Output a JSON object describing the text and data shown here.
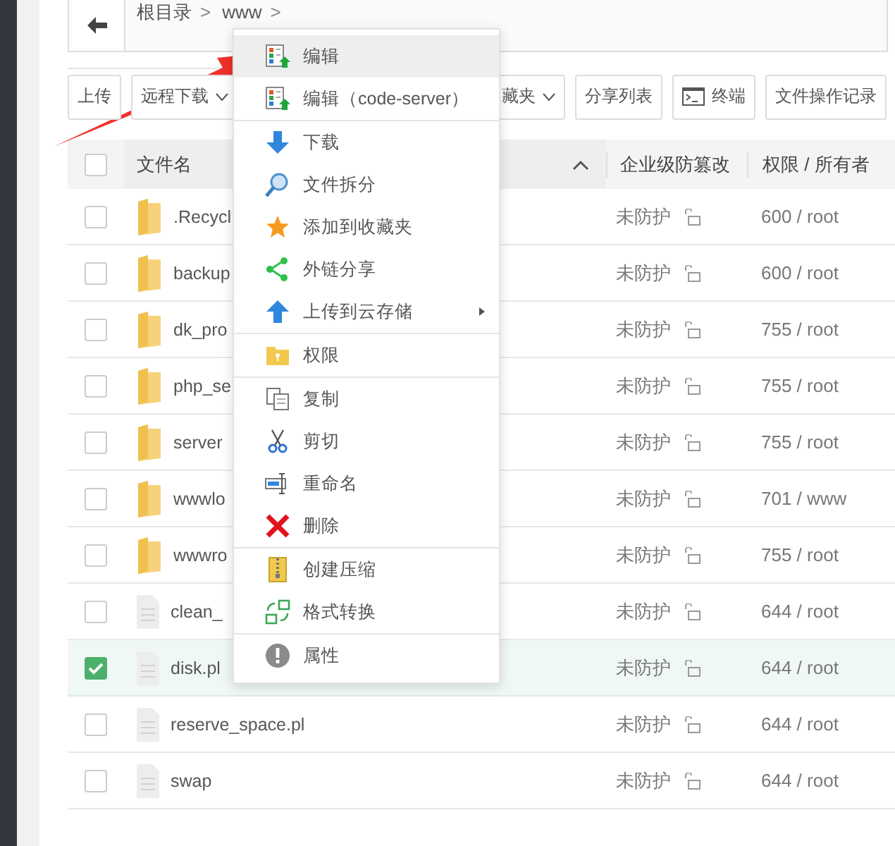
{
  "breadcrumb": {
    "items": [
      "根目录",
      "www"
    ],
    "separator": ">"
  },
  "toolbar": {
    "buttons": [
      {
        "label": "上传",
        "dropdown": false,
        "icon": false
      },
      {
        "label": "远程下载",
        "dropdown": true,
        "icon": false
      },
      {
        "label": "藏夹",
        "dropdown": true,
        "icon": false
      },
      {
        "label": "分享列表",
        "dropdown": false,
        "icon": false
      },
      {
        "label": "终端",
        "dropdown": false,
        "icon": true
      },
      {
        "label": "文件操作记录",
        "dropdown": false,
        "icon": false
      }
    ]
  },
  "table": {
    "columns": [
      "文件名",
      "企业级防篡改",
      "权限 / 所有者"
    ],
    "select_all_checked": false,
    "rows": [
      {
        "kind": "folder",
        "name": ".Recycl",
        "protection": "未防护",
        "permission": "600 / root",
        "checked": false,
        "selected": false
      },
      {
        "kind": "folder",
        "name": "backup",
        "protection": "未防护",
        "permission": "600 / root",
        "checked": false,
        "selected": false
      },
      {
        "kind": "folder",
        "name": "dk_pro",
        "protection": "未防护",
        "permission": "755 / root",
        "checked": false,
        "selected": false
      },
      {
        "kind": "folder",
        "name": "php_se",
        "protection": "未防护",
        "permission": "755 / root",
        "checked": false,
        "selected": false
      },
      {
        "kind": "folder",
        "name": "server",
        "protection": "未防护",
        "permission": "755 / root",
        "checked": false,
        "selected": false
      },
      {
        "kind": "folder",
        "name": "wwwlo",
        "protection": "未防护",
        "permission": "701 / www",
        "checked": false,
        "selected": false
      },
      {
        "kind": "folder",
        "name": "wwwro",
        "protection": "未防护",
        "permission": "755 / root",
        "checked": false,
        "selected": false
      },
      {
        "kind": "file",
        "name": "clean_",
        "protection": "未防护",
        "permission": "644 / root",
        "checked": false,
        "selected": false
      },
      {
        "kind": "file",
        "name": "disk.pl",
        "protection": "未防护",
        "permission": "644 / root",
        "checked": true,
        "selected": true
      },
      {
        "kind": "file",
        "name": "reserve_space.pl",
        "protection": "未防护",
        "permission": "644 / root",
        "checked": false,
        "selected": false
      },
      {
        "kind": "file",
        "name": "swap",
        "protection": "未防护",
        "permission": "644 / root",
        "checked": false,
        "selected": false
      }
    ]
  },
  "context_menu": {
    "sections": [
      [
        {
          "label": "编辑",
          "selected": true,
          "submenu": false
        },
        {
          "label": "编辑（code-server）",
          "selected": false,
          "submenu": false
        }
      ],
      [
        {
          "label": "下载",
          "selected": false,
          "submenu": false
        },
        {
          "label": "文件拆分",
          "selected": false,
          "submenu": false
        },
        {
          "label": "添加到收藏夹",
          "selected": false,
          "submenu": false
        },
        {
          "label": "外链分享",
          "selected": false,
          "submenu": false
        },
        {
          "label": "上传到云存储",
          "selected": false,
          "submenu": true
        }
      ],
      [
        {
          "label": "权限",
          "selected": false,
          "submenu": false
        }
      ],
      [
        {
          "label": "复制",
          "selected": false,
          "submenu": false
        },
        {
          "label": "剪切",
          "selected": false,
          "submenu": false
        },
        {
          "label": "重命名",
          "selected": false,
          "submenu": false
        },
        {
          "label": "删除",
          "selected": false,
          "submenu": false
        }
      ],
      [
        {
          "label": "创建压缩",
          "selected": false,
          "submenu": false
        },
        {
          "label": "格式转换",
          "selected": false,
          "submenu": false
        }
      ],
      [
        {
          "label": "属性",
          "selected": false,
          "submenu": false
        }
      ]
    ]
  }
}
